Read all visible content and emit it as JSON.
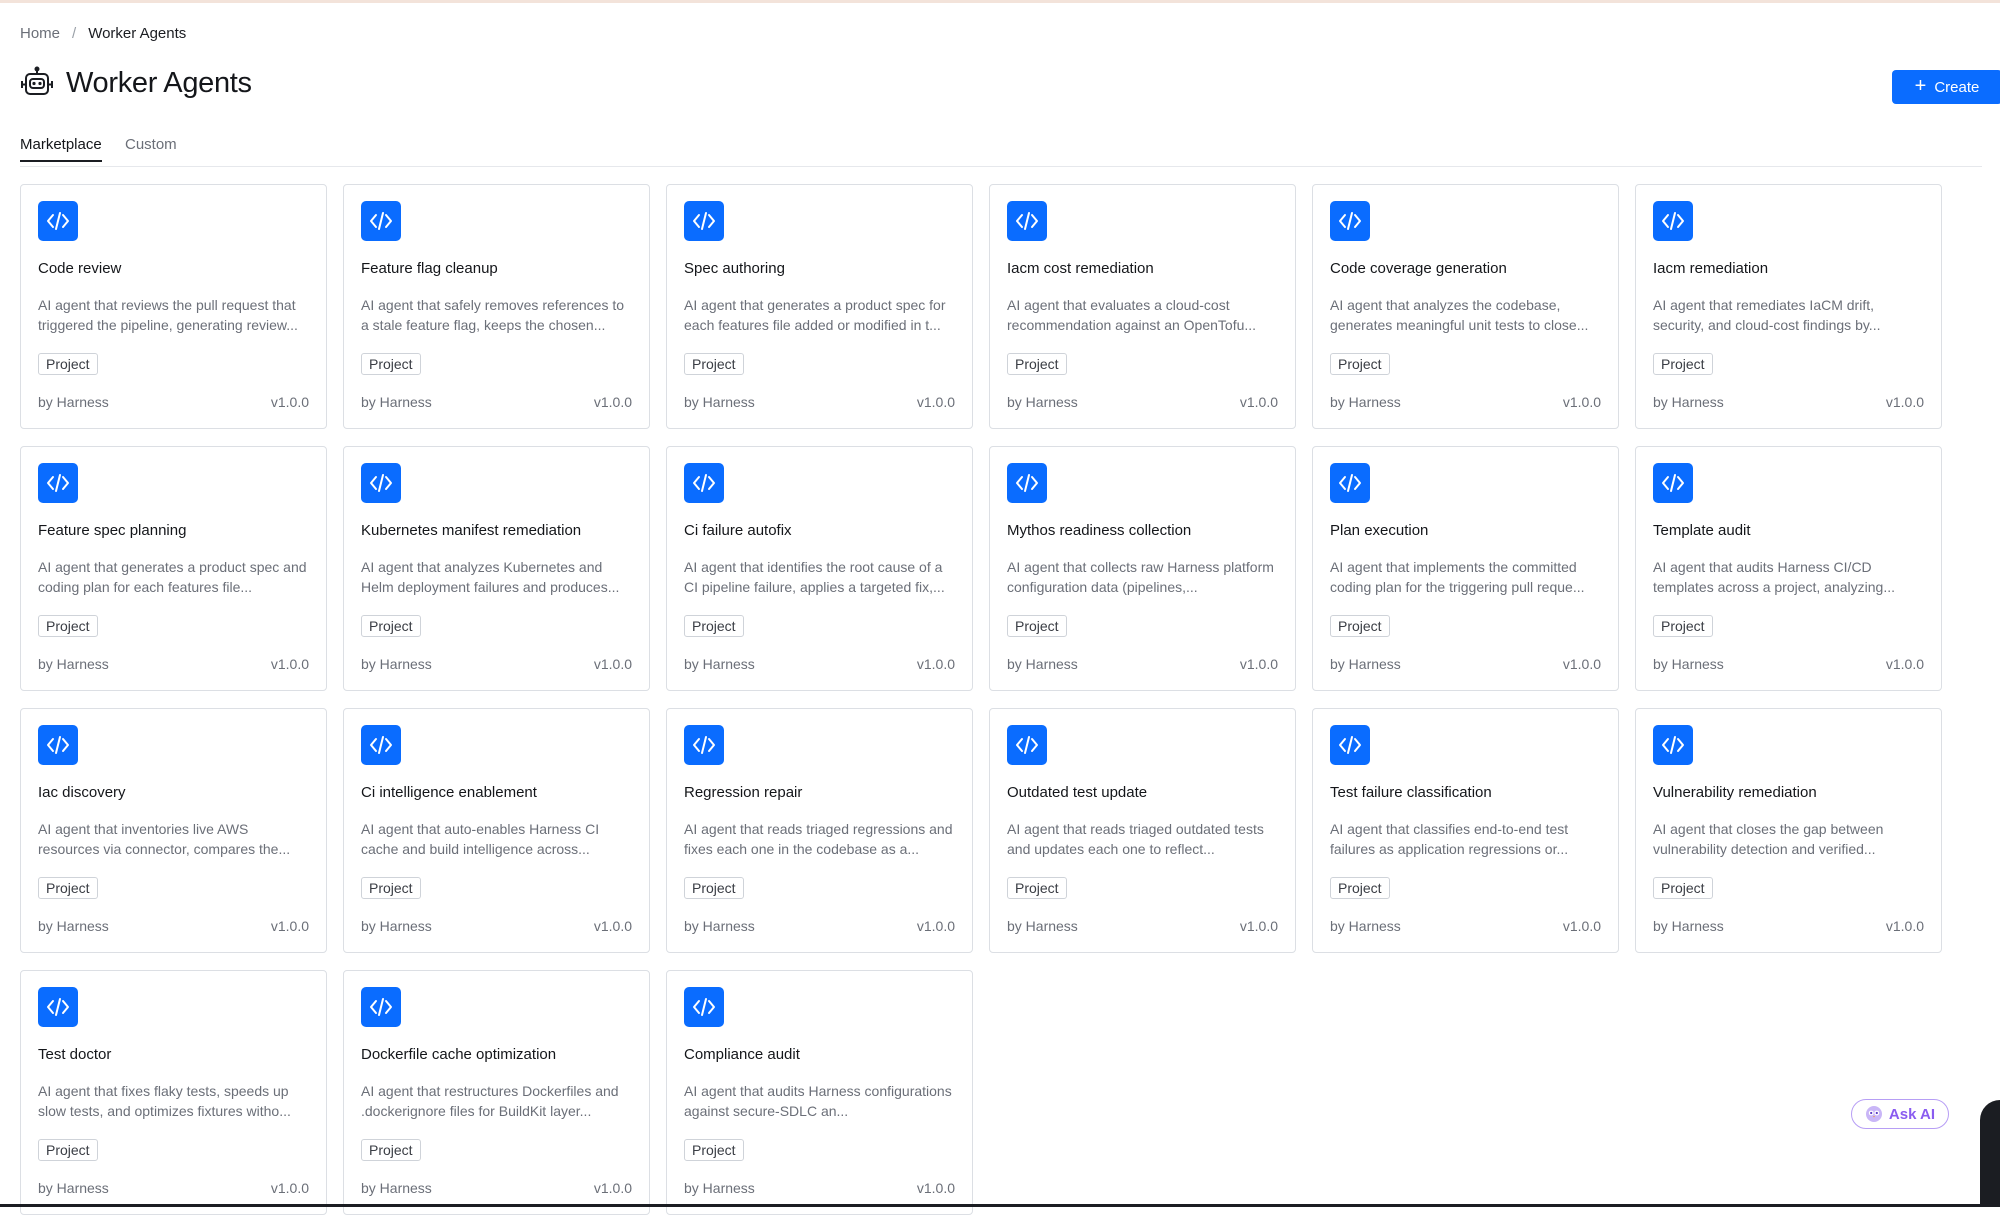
{
  "breadcrumb": {
    "home": "Home",
    "separator": "/",
    "current": "Worker Agents"
  },
  "page": {
    "title": "Worker Agents",
    "icon": "robot-icon"
  },
  "create_button": {
    "label": "Create",
    "icon": "plus-icon"
  },
  "tabs": [
    {
      "label": "Marketplace",
      "active": true
    },
    {
      "label": "Custom",
      "active": false
    }
  ],
  "colors": {
    "accent": "#0a6cff",
    "ask_ai": "#8a5cf0"
  },
  "cards": [
    {
      "name": "Code review",
      "description": "AI agent that reviews the pull request that triggered the pipeline, generating review...",
      "badge": "Project",
      "author": "by Harness",
      "version": "v1.0.0",
      "icon": "code-icon"
    },
    {
      "name": "Feature flag cleanup",
      "description": "AI agent that safely removes references to a stale feature flag, keeps the chosen...",
      "badge": "Project",
      "author": "by Harness",
      "version": "v1.0.0",
      "icon": "code-icon"
    },
    {
      "name": "Spec authoring",
      "description": "AI agent that generates a product spec for each features file added or modified in t...",
      "badge": "Project",
      "author": "by Harness",
      "version": "v1.0.0",
      "icon": "code-icon"
    },
    {
      "name": "Iacm cost remediation",
      "description": "AI agent that evaluates a cloud-cost recommendation against an OpenTofu...",
      "badge": "Project",
      "author": "by Harness",
      "version": "v1.0.0",
      "icon": "code-icon"
    },
    {
      "name": "Code coverage generation",
      "description": "AI agent that analyzes the codebase, generates meaningful unit tests to close...",
      "badge": "Project",
      "author": "by Harness",
      "version": "v1.0.0",
      "icon": "code-icon"
    },
    {
      "name": "Iacm remediation",
      "description": "AI agent that remediates IaCM drift, security, and cloud-cost findings by...",
      "badge": "Project",
      "author": "by Harness",
      "version": "v1.0.0",
      "icon": "code-icon"
    },
    {
      "name": "Feature spec planning",
      "description": "AI agent that generates a product spec and coding plan for each features file...",
      "badge": "Project",
      "author": "by Harness",
      "version": "v1.0.0",
      "icon": "code-icon"
    },
    {
      "name": "Kubernetes manifest remediation",
      "description": "AI agent that analyzes Kubernetes and Helm deployment failures and produces...",
      "badge": "Project",
      "author": "by Harness",
      "version": "v1.0.0",
      "icon": "code-icon"
    },
    {
      "name": "Ci failure autofix",
      "description": "AI agent that identifies the root cause of a CI pipeline failure, applies a targeted fix,...",
      "badge": "Project",
      "author": "by Harness",
      "version": "v1.0.0",
      "icon": "code-icon"
    },
    {
      "name": "Mythos readiness collection",
      "description": "AI agent that collects raw Harness platform configuration data (pipelines,...",
      "badge": "Project",
      "author": "by Harness",
      "version": "v1.0.0",
      "icon": "code-icon"
    },
    {
      "name": "Plan execution",
      "description": "AI agent that implements the committed coding plan for the triggering pull reque...",
      "badge": "Project",
      "author": "by Harness",
      "version": "v1.0.0",
      "icon": "code-icon"
    },
    {
      "name": "Template audit",
      "description": "AI agent that audits Harness CI/CD templates across a project, analyzing...",
      "badge": "Project",
      "author": "by Harness",
      "version": "v1.0.0",
      "icon": "code-icon"
    },
    {
      "name": "Iac discovery",
      "description": "AI agent that inventories live AWS resources via connector, compares the...",
      "badge": "Project",
      "author": "by Harness",
      "version": "v1.0.0",
      "icon": "code-icon"
    },
    {
      "name": "Ci intelligence enablement",
      "description": "AI agent that auto-enables Harness CI cache and build intelligence across...",
      "badge": "Project",
      "author": "by Harness",
      "version": "v1.0.0",
      "icon": "code-icon"
    },
    {
      "name": "Regression repair",
      "description": "AI agent that reads triaged regressions and fixes each one in the codebase as a...",
      "badge": "Project",
      "author": "by Harness",
      "version": "v1.0.0",
      "icon": "code-icon"
    },
    {
      "name": "Outdated test update",
      "description": "AI agent that reads triaged outdated tests and updates each one to reflect...",
      "badge": "Project",
      "author": "by Harness",
      "version": "v1.0.0",
      "icon": "code-icon"
    },
    {
      "name": "Test failure classification",
      "description": "AI agent that classifies end-to-end test failures as application regressions or...",
      "badge": "Project",
      "author": "by Harness",
      "version": "v1.0.0",
      "icon": "code-icon"
    },
    {
      "name": "Vulnerability remediation",
      "description": "AI agent that closes the gap between vulnerability detection and verified...",
      "badge": "Project",
      "author": "by Harness",
      "version": "v1.0.0",
      "icon": "code-icon"
    },
    {
      "name": "Test doctor",
      "description": "AI agent that fixes flaky tests, speeds up slow tests, and optimizes fixtures witho...",
      "badge": "Project",
      "author": "by Harness",
      "version": "v1.0.0",
      "icon": "code-icon"
    },
    {
      "name": "Dockerfile cache optimization",
      "description": "AI agent that restructures Dockerfiles and .dockerignore files for BuildKit layer...",
      "badge": "Project",
      "author": "by Harness",
      "version": "v1.0.0",
      "icon": "code-icon"
    },
    {
      "name": "Compliance audit",
      "description": "AI agent that audits Harness configurations against secure-SDLC an...",
      "badge": "Project",
      "author": "by Harness",
      "version": "v1.0.0",
      "icon": "code-icon"
    }
  ],
  "ask_ai": {
    "label": "Ask AI",
    "icon": "owl-icon"
  }
}
